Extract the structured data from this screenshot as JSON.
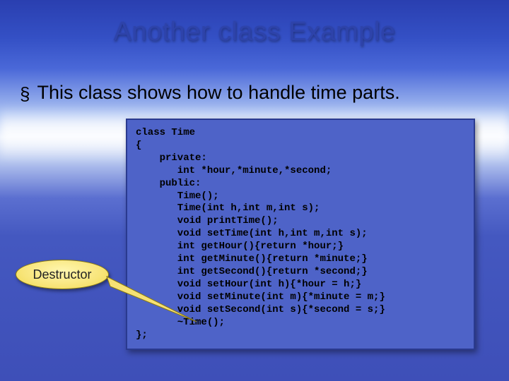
{
  "title": "Another class Example",
  "bullet": {
    "marker": "§",
    "text": "This class shows how to handle time parts."
  },
  "callout": {
    "label": "Destructor"
  },
  "code": {
    "lines": [
      "class Time",
      "{",
      "    private:",
      "       int *hour,*minute,*second;",
      "    public:",
      "       Time();",
      "       Time(int h,int m,int s);",
      "       void printTime();",
      "       void setTime(int h,int m,int s);",
      "       int getHour(){return *hour;}",
      "       int getMinute(){return *minute;}",
      "       int getSecond(){return *second;}",
      "       void setHour(int h){*hour = h;}",
      "       void setMinute(int m){*minute = m;}",
      "       void setSecond(int s){*second = s;}",
      "       ~Time();",
      "};"
    ]
  },
  "colors": {
    "title": "#2e43aa",
    "codeBg": "#4e63c8",
    "codeBorder": "#2a3a8f",
    "calloutFill": "#f8e57a"
  }
}
